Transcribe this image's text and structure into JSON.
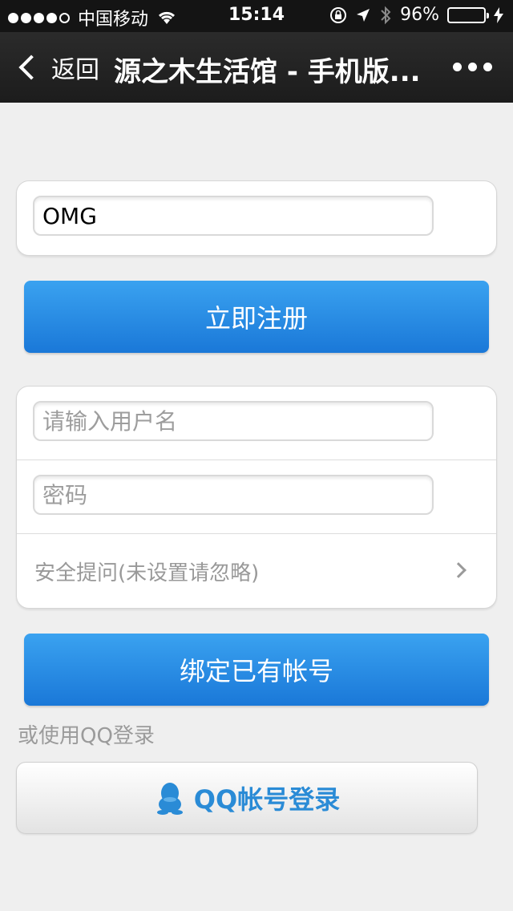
{
  "status_bar": {
    "carrier": "中国移动",
    "time": "15:14",
    "battery": "96%",
    "battery_level": 0.96
  },
  "nav": {
    "back_label": "返回",
    "title": "源之木生活馆 - 手机版..."
  },
  "register_form": {
    "name_value": "OMG",
    "submit_label": "立即注册"
  },
  "bind_form": {
    "username_placeholder": "请输入用户名",
    "password_placeholder": "密码",
    "security_question_label": "安全提问(未设置请忽略)",
    "submit_label": "绑定已有帐号"
  },
  "alt_login": {
    "hint": "或使用QQ登录",
    "qq_button_label": "QQ帐号登录"
  },
  "colors": {
    "accent": "#2a8bd6",
    "button_blue": "#1a78d8",
    "battery_green": "#4cd964"
  }
}
